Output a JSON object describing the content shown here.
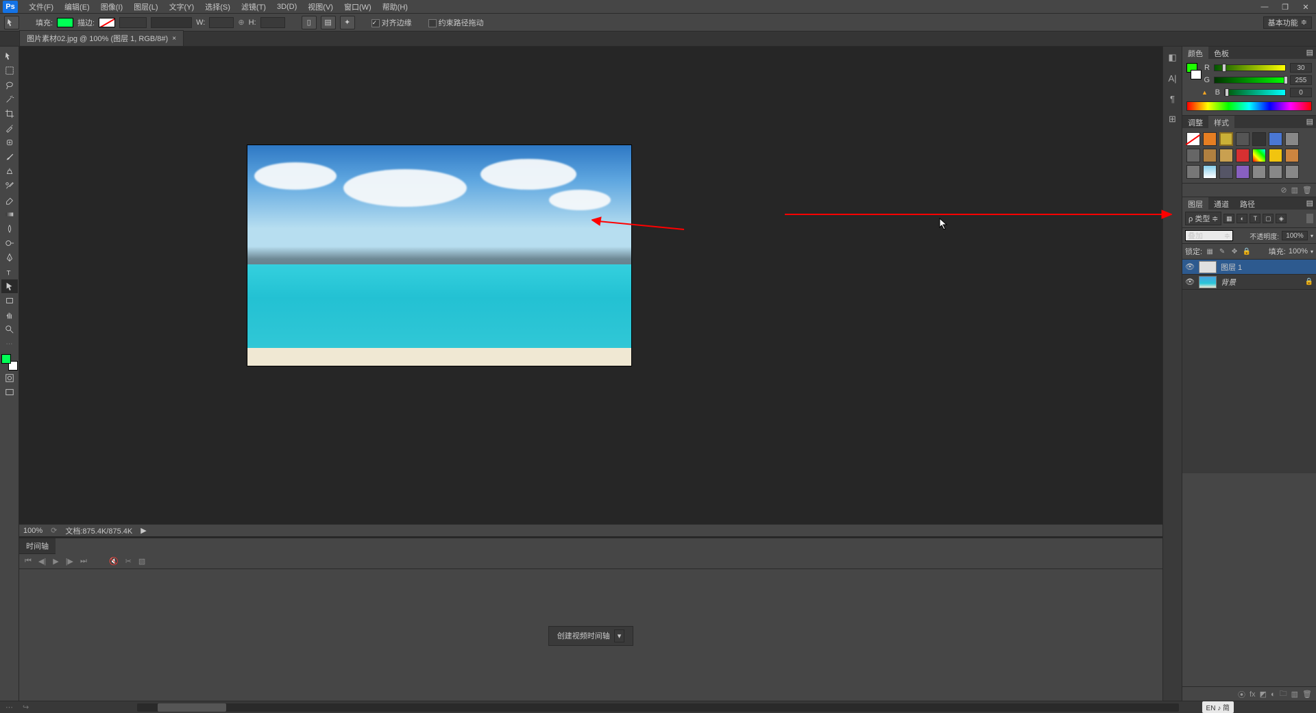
{
  "app": {
    "logo": "Ps"
  },
  "menu": {
    "file": "文件(F)",
    "edit": "编辑(E)",
    "image": "图像(I)",
    "layer": "图层(L)",
    "type": "文字(Y)",
    "select": "选择(S)",
    "filter": "滤镜(T)",
    "three_d": "3D(D)",
    "view": "视图(V)",
    "window": "窗口(W)",
    "help": "帮助(H)"
  },
  "window_controls": {
    "min": "—",
    "max": "❐",
    "close": "✕"
  },
  "options": {
    "fill_label": "填充:",
    "stroke_label": "描边:",
    "w_label": "W:",
    "h_label": "H:",
    "align_edges": "对齐边缘",
    "constrain_path": "约束路径拖动",
    "workspace": "基本功能"
  },
  "doc": {
    "tab_title": "图片素材02.jpg @ 100% (图层 1, RGB/8#)",
    "close": "×"
  },
  "status": {
    "zoom": "100%",
    "doc_info": "文档:875.4K/875.4K",
    "arrow": "▶"
  },
  "timeline": {
    "tab": "时间轴",
    "create_btn": "创建视频时间轴",
    "dd": "▾"
  },
  "color_panel": {
    "tab_color": "颜色",
    "tab_swatch": "色板",
    "r": "R",
    "r_val": "30",
    "g": "G",
    "g_val": "255",
    "b": "B",
    "b_val": "0",
    "fg_color": "#1eff00",
    "bg_color": "#ffffff"
  },
  "adj_panel": {
    "tab_adj": "调整",
    "tab_style": "样式"
  },
  "layers_panel": {
    "tab_layers": "图层",
    "tab_channels": "通道",
    "tab_paths": "路径",
    "filter_kind": "ρ 类型",
    "filter_dd": "≑",
    "blend_mode": "叠加",
    "blend_dd": "≑",
    "opacity_label": "不透明度:",
    "opacity_val": "100%",
    "lock_label": "锁定:",
    "fill_label": "填充:",
    "fill_val": "100%",
    "layer1_name": "图层 1",
    "bg_name": "背景",
    "eye": "👁"
  },
  "lang_badge": "EN ♪ 简",
  "tooltip": ""
}
